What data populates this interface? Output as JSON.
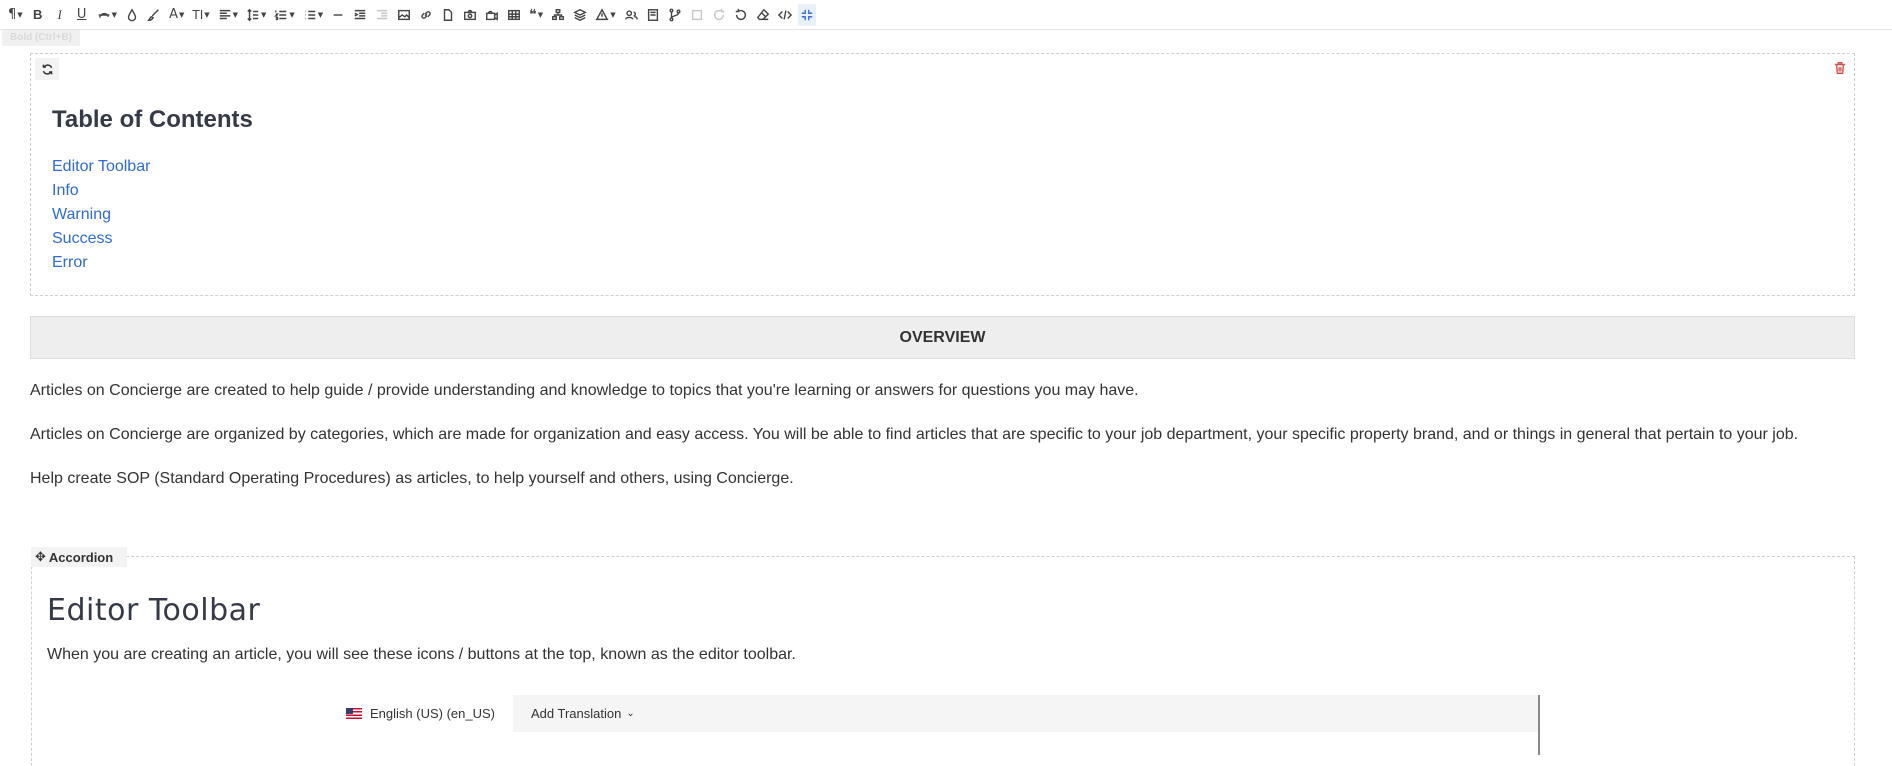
{
  "toolbar": {
    "tooltip": "Bold (Ctrl+B)",
    "buttons": [
      {
        "name": "paragraph-format",
        "glyph": "¶",
        "caret": true
      },
      {
        "name": "bold",
        "glyph": "B",
        "caret": false
      },
      {
        "name": "italic",
        "glyph": "I",
        "caret": false
      },
      {
        "name": "underline",
        "glyph": "U",
        "caret": false
      },
      {
        "name": "strikethrough-style",
        "glyph": "S",
        "caret": true
      },
      {
        "name": "text-color",
        "glyph": "◔",
        "caret": false
      },
      {
        "name": "background-color",
        "glyph": "✎",
        "caret": false
      },
      {
        "name": "font-family",
        "glyph": "A",
        "caret": true
      },
      {
        "name": "font-size",
        "glyph": "TI",
        "caret": true
      },
      {
        "name": "align",
        "glyph": "≡",
        "caret": true
      },
      {
        "name": "line-height",
        "glyph": "↕",
        "caret": true
      },
      {
        "name": "ordered-list",
        "glyph": "☰",
        "caret": true
      },
      {
        "name": "unordered-list",
        "glyph": "☰",
        "caret": true
      },
      {
        "name": "horizontal-line",
        "glyph": "—",
        "caret": false
      },
      {
        "name": "indent",
        "glyph": "⇥",
        "caret": false
      },
      {
        "name": "outdent",
        "glyph": "⇤",
        "caret": false
      },
      {
        "name": "insert-image",
        "glyph": "▣",
        "caret": false
      },
      {
        "name": "insert-link",
        "glyph": "🔗",
        "caret": false
      },
      {
        "name": "insert-file",
        "glyph": "▯",
        "caret": false
      },
      {
        "name": "insert-camera",
        "glyph": "◉",
        "caret": false
      },
      {
        "name": "insert-video",
        "glyph": "▶",
        "caret": false
      },
      {
        "name": "insert-table",
        "glyph": "⊞",
        "caret": false
      },
      {
        "name": "quote",
        "glyph": "❝",
        "caret": true
      },
      {
        "name": "org-chart",
        "glyph": "⊤",
        "caret": false
      },
      {
        "name": "layers",
        "glyph": "◈",
        "caret": false
      },
      {
        "name": "shapes",
        "glyph": "△",
        "caret": true
      },
      {
        "name": "users",
        "glyph": "☺",
        "caret": false
      },
      {
        "name": "book",
        "glyph": "▤",
        "caret": false
      },
      {
        "name": "branch",
        "glyph": "⑂",
        "caret": false
      },
      {
        "name": "select-all",
        "glyph": "□",
        "caret": false
      },
      {
        "name": "redo",
        "glyph": "↻",
        "caret": false
      },
      {
        "name": "undo",
        "glyph": "↺",
        "caret": false
      },
      {
        "name": "clear-formatting",
        "glyph": "⌫",
        "caret": false
      },
      {
        "name": "code-view",
        "glyph": "</>",
        "caret": false
      },
      {
        "name": "fullscreen",
        "glyph": "⤡",
        "caret": false
      }
    ]
  },
  "toc": {
    "title": "Table of Contents",
    "links": [
      "Editor Toolbar",
      "Info",
      "Warning",
      "Success",
      "Error"
    ]
  },
  "overview": {
    "heading": "OVERVIEW",
    "paragraphs": [
      "Articles on Concierge are created to help guide / provide understanding and knowledge to topics that you're learning or answers for questions you may have.",
      "Articles on Concierge are organized by categories, which are made for organization and easy access. You will be able to find articles that are specific to your job department, your specific property brand, and or things in general that pertain to your job.",
      "Help create SOP (Standard Operating Procedures) as articles, to help yourself and others, using Concierge."
    ]
  },
  "accordion": {
    "tag": "Accordion",
    "title": "Editor Toolbar",
    "description": "When you are creating an article, you will see these icons / buttons at the top, known as the editor toolbar."
  },
  "embed": {
    "language": "English (US) (en_US)",
    "add_translation": "Add Translation"
  },
  "colors": {
    "link": "#2f6bd0",
    "heading": "#343a47",
    "delete": "#d9534f"
  }
}
